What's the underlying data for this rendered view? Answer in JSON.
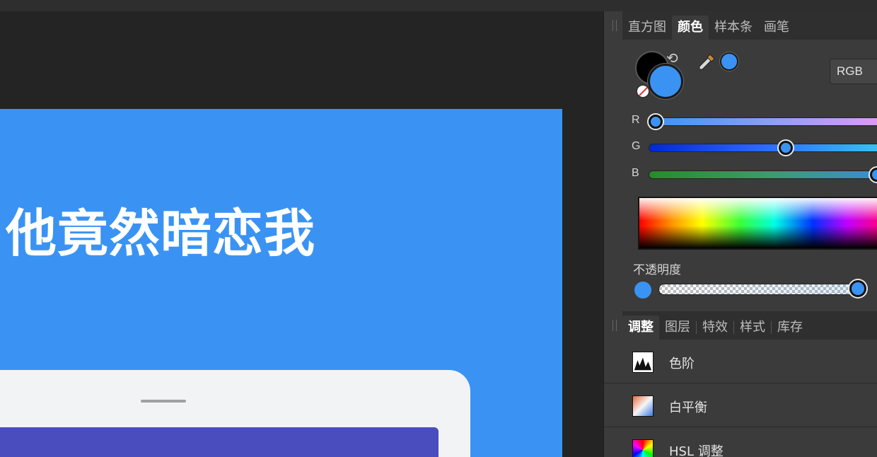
{
  "canvas": {
    "headline": "他竟然暗恋我"
  },
  "panel_top": {
    "tabs": [
      {
        "label": "直方图",
        "active": false
      },
      {
        "label": "颜色",
        "active": true
      },
      {
        "label": "样本条",
        "active": false
      },
      {
        "label": "画笔",
        "active": false
      }
    ]
  },
  "color": {
    "fill_color": "#3a93f3",
    "stroke_color": "#000000",
    "mode": "RGB",
    "sliders": [
      {
        "label": "R",
        "value": 0.03
      },
      {
        "label": "G",
        "value": 0.57
      },
      {
        "label": "B",
        "value": 0.95
      }
    ],
    "opacity_label": "不透明度",
    "opacity_value": 1.0
  },
  "panel_bottom": {
    "tabs": [
      {
        "label": "调整",
        "active": true
      },
      {
        "label": "图层",
        "active": false
      },
      {
        "label": "特效",
        "active": false
      },
      {
        "label": "样式",
        "active": false
      },
      {
        "label": "库存",
        "active": false
      }
    ],
    "items": [
      {
        "label": "色阶",
        "icon": "levels-icon"
      },
      {
        "label": "白平衡",
        "icon": "white-balance-icon"
      },
      {
        "label": "HSL 调整",
        "icon": "hsl-icon"
      }
    ]
  }
}
